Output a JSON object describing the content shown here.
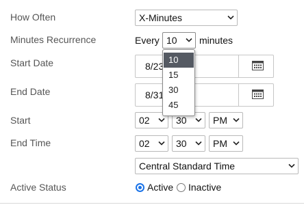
{
  "labels": {
    "how_often": "How Often",
    "minutes_recurrence": "Minutes Recurrence",
    "start_date": "Start Date",
    "end_date": "End Date",
    "start": "Start",
    "end_time": "End Time",
    "active_status": "Active Status"
  },
  "how_often": {
    "value": "X-Minutes"
  },
  "recurrence": {
    "prefix": "Every",
    "value": "10",
    "suffix": "minutes",
    "options": [
      "10",
      "15",
      "30",
      "45"
    ],
    "highlighted": "10"
  },
  "start_date": {
    "value": "8/23"
  },
  "end_date": {
    "value": "8/31"
  },
  "start": {
    "hour": "02",
    "minute": "30",
    "ampm": "PM"
  },
  "end_time": {
    "hour": "02",
    "minute": "30",
    "ampm": "PM"
  },
  "timezone": {
    "value": "Central Standard Time"
  },
  "status": {
    "active_label": "Active",
    "inactive_label": "Inactive",
    "selected": "Active"
  },
  "colors": {
    "accent": "#1a73e8",
    "dropdown_highlight": "#555a63"
  },
  "icons": {
    "chevron": "chevron-down-icon",
    "calendar": "calendar-icon"
  }
}
